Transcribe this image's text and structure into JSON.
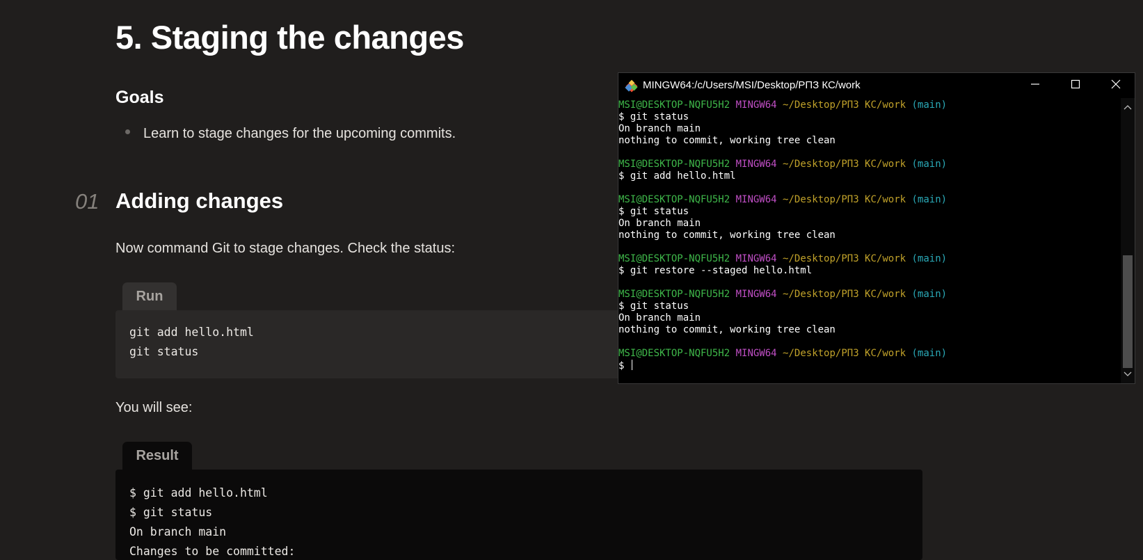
{
  "article": {
    "title": "5. Staging the changes",
    "goals_heading": "Goals",
    "goals": [
      "Learn to stage changes for the upcoming commits."
    ],
    "section_number": "01",
    "section_title": "Adding changes",
    "instruction": "Now command Git to stage changes. Check the status:",
    "run_label": "Run",
    "run_code": [
      "git add hello.html",
      "git status"
    ],
    "see_text": "You will see:",
    "result_label": "Result",
    "result_code": [
      "$ git add hello.html",
      "$ git status",
      "On branch main",
      "Changes to be committed:"
    ]
  },
  "terminal": {
    "title": "MINGW64:/c/Users/MSI/Desktop/РПЗ КС/work",
    "prompt": {
      "user_host": "MSI@DESKTOP-NQFU5H2",
      "system": "MINGW64",
      "path": "~/Desktop/РПЗ КС/work",
      "branch": "(main)"
    },
    "lines": [
      {
        "kind": "prompt"
      },
      {
        "kind": "text",
        "text": "$ git status"
      },
      {
        "kind": "text",
        "text": "On branch main"
      },
      {
        "kind": "text",
        "text": "nothing to commit, working tree clean"
      },
      {
        "kind": "blank"
      },
      {
        "kind": "prompt"
      },
      {
        "kind": "text",
        "text": "$ git add hello.html"
      },
      {
        "kind": "blank"
      },
      {
        "kind": "prompt"
      },
      {
        "kind": "text",
        "text": "$ git status"
      },
      {
        "kind": "text",
        "text": "On branch main"
      },
      {
        "kind": "text",
        "text": "nothing to commit, working tree clean"
      },
      {
        "kind": "blank"
      },
      {
        "kind": "prompt"
      },
      {
        "kind": "text",
        "text": "$ git restore --staged hello.html"
      },
      {
        "kind": "blank"
      },
      {
        "kind": "prompt"
      },
      {
        "kind": "text",
        "text": "$ git status"
      },
      {
        "kind": "text",
        "text": "On branch main"
      },
      {
        "kind": "text",
        "text": "nothing to commit, working tree clean"
      },
      {
        "kind": "blank"
      },
      {
        "kind": "prompt"
      },
      {
        "kind": "input",
        "text": "$ "
      }
    ],
    "icons": {
      "app": "git-bash-icon",
      "minimize": "minimize-icon",
      "maximize": "maximize-icon",
      "close": "close-icon"
    },
    "colors": {
      "user_host": "#3fb84a",
      "system": "#c14fc6",
      "path": "#c1a22a",
      "branch": "#2aaab8"
    }
  },
  "colors": {
    "page_background": "#201e1d",
    "code_background": "#2a2827",
    "result_background": "#0b0a0a"
  }
}
